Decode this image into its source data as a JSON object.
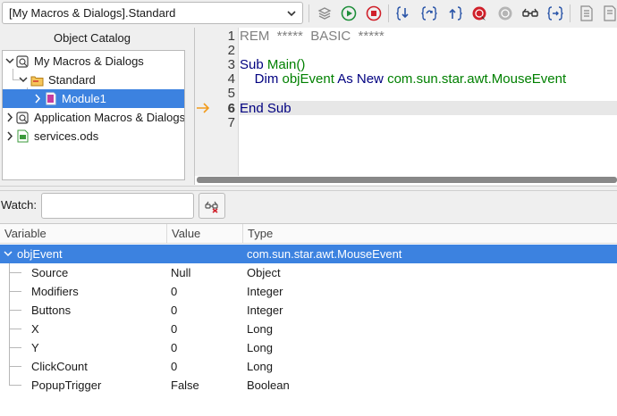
{
  "toolbar": {
    "library_select": "[My Macros & Dialogs].Standard",
    "icons": [
      "macro-library-icon",
      "run-icon",
      "stop-icon",
      "step-into-icon",
      "step-over-icon",
      "step-out-icon",
      "breakpoint-icon",
      "breakpoint-off-icon",
      "watch-icon",
      "find-parentheses-icon",
      "insert-source-icon",
      "save-source-icon"
    ]
  },
  "catalog": {
    "title": "Object Catalog",
    "nodes": [
      "My Macros & Dialogs",
      "Standard",
      "Module1",
      "Application Macros & Dialogs",
      "services.ods"
    ]
  },
  "editor": {
    "line_numbers": [
      "1",
      "2",
      "3",
      "4",
      "5",
      "6",
      "7"
    ],
    "lines": {
      "l1_rem": "REM",
      "l1_rest": "  *****  BASIC  *****",
      "l3_sub": "Sub ",
      "l3_name": "Main()",
      "l4_dim": "    Dim ",
      "l4_var": "objEvent",
      "l4_as": " As New ",
      "l4_type": "com.sun.star.awt.MouseEvent",
      "l6_end": "End Sub"
    },
    "current_line": "6"
  },
  "watch": {
    "label": "Watch:",
    "input_value": "",
    "columns": [
      "Variable",
      "Value",
      "Type"
    ],
    "parent": {
      "variable": "objEvent",
      "value": "",
      "type": "com.sun.star.awt.MouseEvent"
    },
    "rows": [
      {
        "variable": "Source",
        "value": "Null",
        "type": "Object"
      },
      {
        "variable": "Modifiers",
        "value": "0",
        "type": "Integer"
      },
      {
        "variable": "Buttons",
        "value": "0",
        "type": "Integer"
      },
      {
        "variable": "X",
        "value": "0",
        "type": "Long"
      },
      {
        "variable": "Y",
        "value": "0",
        "type": "Long"
      },
      {
        "variable": "ClickCount",
        "value": "0",
        "type": "Long"
      },
      {
        "variable": "PopupTrigger",
        "value": "False",
        "type": "Boolean"
      }
    ]
  },
  "colors": {
    "selection": "#3c82e0",
    "keyword": "#000080",
    "identifier": "#008000",
    "comment": "#808080"
  }
}
